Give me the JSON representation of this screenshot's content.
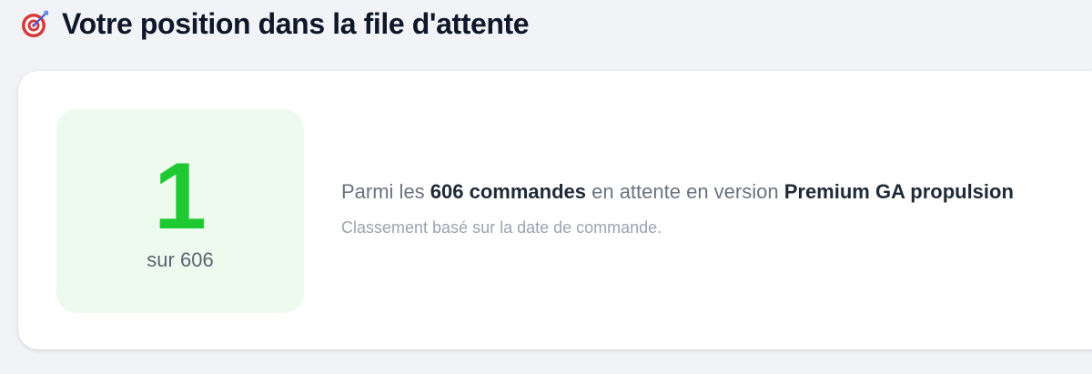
{
  "header": {
    "icon": "direct-hit-target-icon",
    "title": "Votre position dans la file d'attente"
  },
  "position": {
    "rank": "1",
    "total_text": "sur 606"
  },
  "info": {
    "prefix": "Parmi les ",
    "orders_count": "606 commandes",
    "middle": " en attente en version ",
    "version": "Premium GA propulsion",
    "note": "Classement basé sur la date de commande."
  },
  "colors": {
    "accent_green": "#1ec932",
    "position_bg": "#edfbee",
    "page_bg": "#f2f3f6",
    "target_red": "#d83a3a"
  }
}
